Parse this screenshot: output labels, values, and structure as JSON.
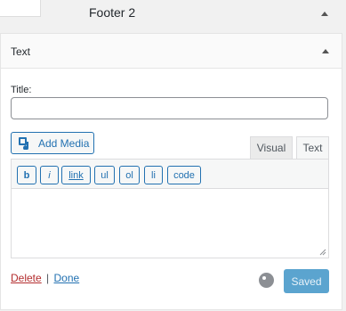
{
  "sidebar": {
    "title": "Footer 2"
  },
  "widget": {
    "title": "Text",
    "title_label": "Title:",
    "title_value": "",
    "add_media_label": "Add Media",
    "tabs": [
      {
        "label": "Visual"
      },
      {
        "label": "Text"
      }
    ],
    "quicktags": [
      {
        "label": "b"
      },
      {
        "label": "i"
      },
      {
        "label": "link"
      },
      {
        "label": "ul"
      },
      {
        "label": "ol"
      },
      {
        "label": "li"
      },
      {
        "label": "code"
      }
    ],
    "content": "",
    "delete_label": "Delete",
    "separator": "|",
    "done_label": "Done",
    "saved_label": "Saved"
  },
  "colors": {
    "accent": "#2271b1",
    "delete": "#b32d2e",
    "saved_bg": "#5ba4cf"
  },
  "icons": {
    "collapse": "arrow-up-icon",
    "media": "add-media-icon",
    "spinner": "spinner-icon",
    "resize": "resize-handle-icon"
  }
}
